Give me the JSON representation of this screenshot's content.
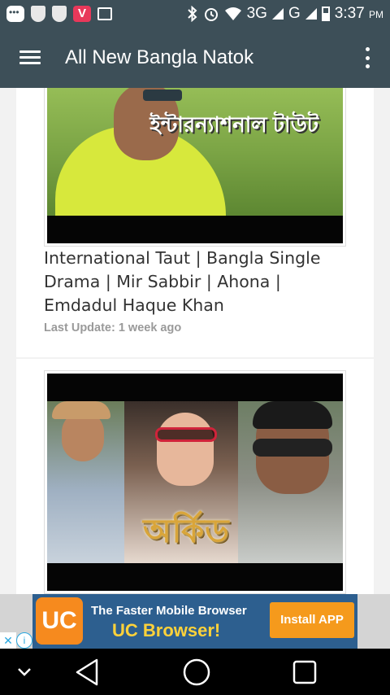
{
  "status_bar": {
    "time": "3:37",
    "ampm": "PM",
    "network_1": "3G",
    "network_2": "G",
    "icons": [
      "chat-icon",
      "shield-icon",
      "shield-icon",
      "vivaldi-icon",
      "image-icon",
      "bluetooth-icon",
      "alarm-icon",
      "wifi-icon",
      "signal-icon",
      "signal-icon",
      "battery-icon"
    ]
  },
  "app_bar": {
    "title": "All New Bangla Natok",
    "menu_icon": "hamburger-menu-icon",
    "overflow_icon": "more-vert-icon"
  },
  "cards": [
    {
      "thumbnail_text": "ইন্টারন্যাশনাল টাউট",
      "title": "International Taut | Bangla Single Drama | Mir Sabbir | Ahona | Emdadul Haque Khan",
      "meta": "Last Update: 1 week ago"
    },
    {
      "thumbnail_text": "অর্কিড"
    }
  ],
  "ad": {
    "logo_text": "UC",
    "line1": "The Faster Mobile Browser",
    "line2": "UC Browser!",
    "cta": "Install APP",
    "close_label": "✕",
    "info_label": "i"
  },
  "nav_bar": {
    "buttons": [
      "collapse-icon",
      "back-icon",
      "home-icon",
      "recents-icon"
    ]
  }
}
